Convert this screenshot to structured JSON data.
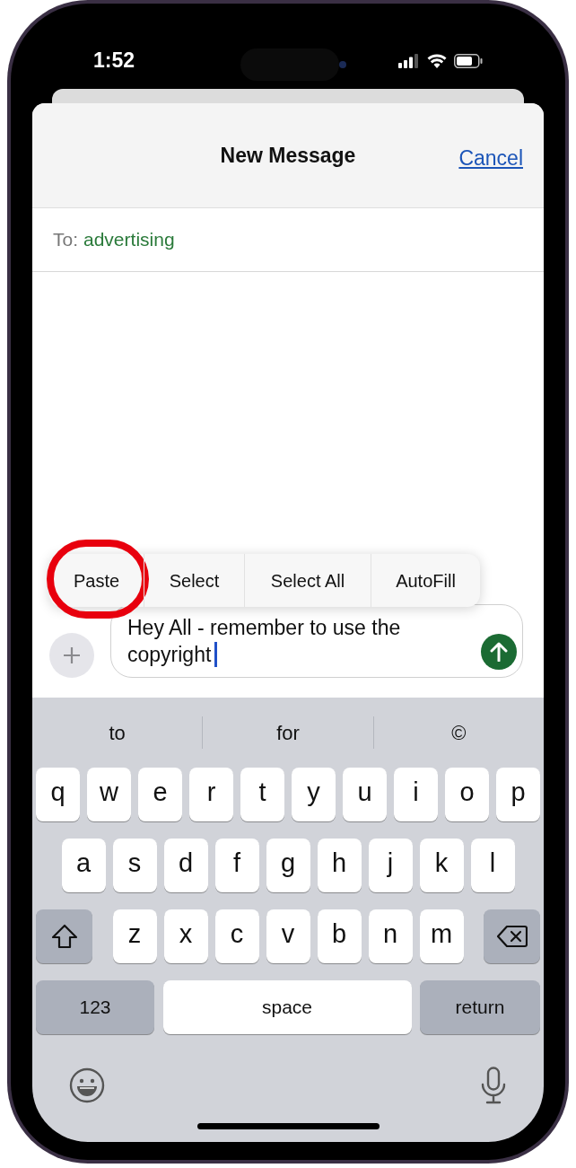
{
  "status_bar": {
    "time": "1:52"
  },
  "sheet": {
    "title": "New Message",
    "cancel": "Cancel",
    "to_label": "To:",
    "recipient": "advertising"
  },
  "edit_menu": {
    "items": [
      {
        "label": "Paste",
        "annotated": true
      },
      {
        "label": "Select",
        "annotated": false
      },
      {
        "label": "Select All",
        "annotated": false
      },
      {
        "label": "AutoFill",
        "annotated": false
      }
    ]
  },
  "compose": {
    "text_lines": [
      "Hey All - remember to use the",
      "copyright"
    ]
  },
  "keyboard": {
    "suggestions": [
      "to",
      "for",
      "©"
    ],
    "rows": [
      {
        "keys": [
          {
            "kind": "char",
            "label": "q"
          },
          {
            "kind": "char",
            "label": "w"
          },
          {
            "kind": "char",
            "label": "e"
          },
          {
            "kind": "char",
            "label": "r"
          },
          {
            "kind": "char",
            "label": "t"
          },
          {
            "kind": "char",
            "label": "y"
          },
          {
            "kind": "char",
            "label": "u"
          },
          {
            "kind": "char",
            "label": "i"
          },
          {
            "kind": "char",
            "label": "o"
          },
          {
            "kind": "char",
            "label": "p"
          }
        ]
      },
      {
        "keys": [
          {
            "kind": "char",
            "label": "a"
          },
          {
            "kind": "char",
            "label": "s"
          },
          {
            "kind": "char",
            "label": "d"
          },
          {
            "kind": "char",
            "label": "f"
          },
          {
            "kind": "char",
            "label": "g"
          },
          {
            "kind": "char",
            "label": "h"
          },
          {
            "kind": "char",
            "label": "j"
          },
          {
            "kind": "char",
            "label": "k"
          },
          {
            "kind": "char",
            "label": "l"
          }
        ]
      },
      {
        "keys": [
          {
            "kind": "shift"
          },
          {
            "kind": "char",
            "label": "z"
          },
          {
            "kind": "char",
            "label": "x"
          },
          {
            "kind": "char",
            "label": "c"
          },
          {
            "kind": "char",
            "label": "v"
          },
          {
            "kind": "char",
            "label": "b"
          },
          {
            "kind": "char",
            "label": "n"
          },
          {
            "kind": "char",
            "label": "m"
          },
          {
            "kind": "delete"
          }
        ]
      },
      {
        "keys": [
          {
            "kind": "mode",
            "label": "123"
          },
          {
            "kind": "space",
            "label": "space"
          },
          {
            "kind": "return",
            "label": "return"
          }
        ]
      }
    ]
  }
}
